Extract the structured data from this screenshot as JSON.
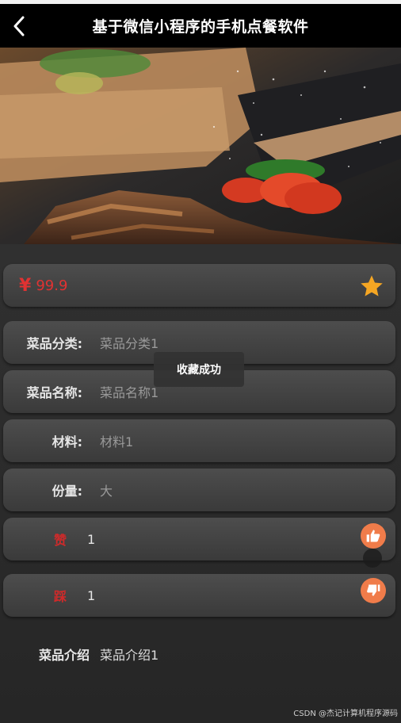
{
  "navbar": {
    "title": "基于微信小程序的手机点餐软件",
    "back_icon": "back-arrow-icon"
  },
  "hero": {
    "image_description_icon": "food-photo"
  },
  "price": {
    "currency": "¥",
    "amount": "99.9",
    "favorite_icon": "star-icon",
    "favorite_color": "#f5a623"
  },
  "fields": [
    {
      "label": "菜品分类:",
      "value": "菜品分类1"
    },
    {
      "label": "菜品名称:",
      "value": "菜品名称1"
    },
    {
      "label": "材料:",
      "value": "材料1"
    },
    {
      "label": "份量:",
      "value": "大"
    }
  ],
  "votes": {
    "up": {
      "label": "赞",
      "count": "1",
      "icon": "thumbs-up-icon"
    },
    "down": {
      "label": "踩",
      "count": "1",
      "icon": "thumbs-down-icon"
    },
    "button_color": "#f07c4a"
  },
  "intro": {
    "label": "菜品介绍",
    "value": "菜品介绍1"
  },
  "toast": {
    "text": "收藏成功"
  },
  "watermark": "CSDN @杰记计算机程序源码"
}
